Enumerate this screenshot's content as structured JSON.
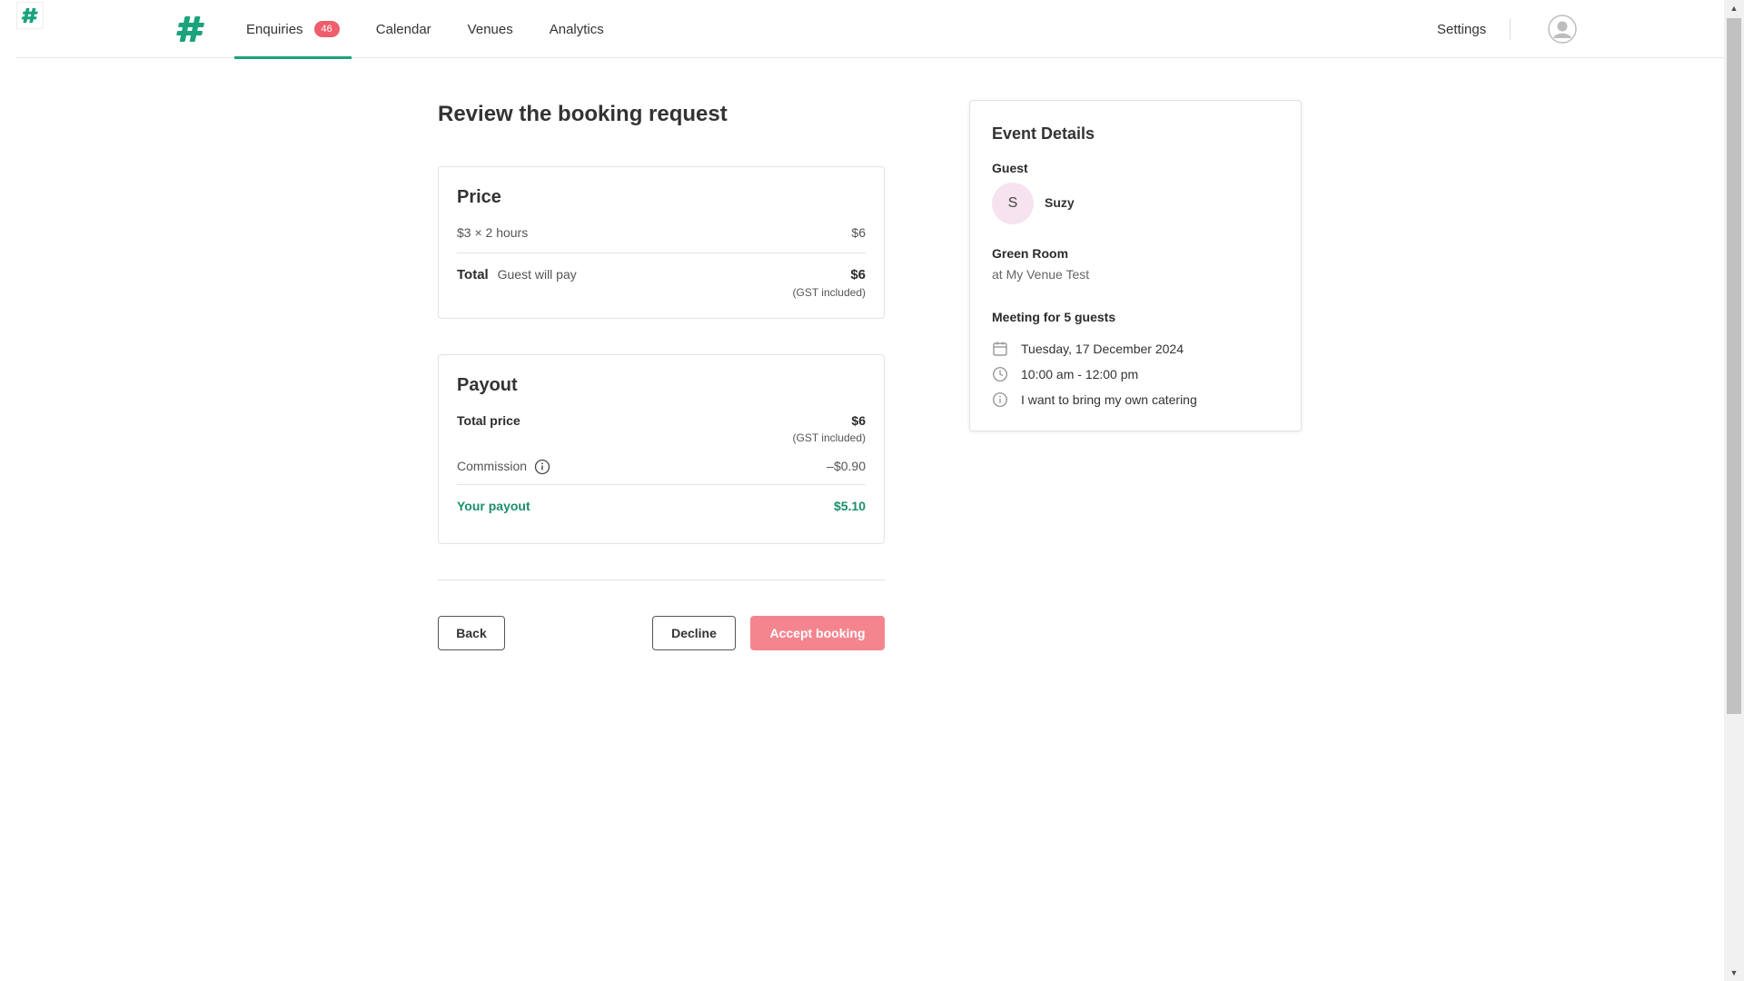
{
  "header": {
    "nav": [
      {
        "label": "Enquiries",
        "badge": "46",
        "active": true
      },
      {
        "label": "Calendar"
      },
      {
        "label": "Venues"
      },
      {
        "label": "Analytics"
      }
    ],
    "settings_label": "Settings"
  },
  "page_title": "Review the booking request",
  "price": {
    "heading": "Price",
    "line_label": "$3 × 2 hours",
    "line_value": "$6",
    "total_label": "Total",
    "total_sublabel": "Guest will pay",
    "total_value": "$6",
    "total_note": "(GST included)"
  },
  "payout": {
    "heading": "Payout",
    "total_price_label": "Total price",
    "total_price_value": "$6",
    "total_price_note": "(GST included)",
    "commission_label": "Commission",
    "commission_value": "–$0.90",
    "your_payout_label": "Your payout",
    "your_payout_value": "$5.10"
  },
  "actions": {
    "back": "Back",
    "decline": "Decline",
    "accept": "Accept booking"
  },
  "event": {
    "title": "Event Details",
    "guest_label": "Guest",
    "guest_initial": "S",
    "guest_name": "Suzy",
    "room": "Green Room",
    "venue": "at My Venue Test",
    "meeting": "Meeting for 5 guests",
    "date": "Tuesday, 17 December 2024",
    "time": "10:00 am - 12:00 pm",
    "note": "I want to bring my own catering"
  },
  "colors": {
    "brand_green": "#1ba37e",
    "badge_red": "#ef5e6c",
    "accept_pink": "#f4858f",
    "payout_green": "#1a8f6b"
  },
  "icons": [
    "logo-icon",
    "calendar-icon",
    "clock-icon",
    "info-icon",
    "user-avatar-icon"
  ]
}
